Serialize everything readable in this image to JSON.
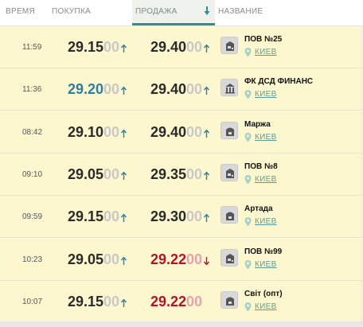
{
  "header": {
    "time_label": "ВРЕМЯ",
    "buy_label": "ПОКУПКА",
    "sell_label": "ПРОДАЖА",
    "name_label": "НАЗВАНИЕ"
  },
  "colors": {
    "row_bg": "#fdf7cf",
    "accent_teal": "#2f8f8a",
    "up_blue": "#2c7ea4",
    "down_red": "#b3142c"
  },
  "rows": [
    {
      "time": "11:59",
      "buy_main": "29.15",
      "buy_dim": "00",
      "buy_arrow": "up",
      "buy_style": "normal",
      "sell_main": "29.40",
      "sell_dim": "00",
      "sell_arrow": "up",
      "sell_style": "normal",
      "icon": "bank-icon",
      "name": "ПОВ №25",
      "city": "КИЕВ"
    },
    {
      "time": "11:36",
      "buy_main": "29.20",
      "buy_dim": "00",
      "buy_arrow": "up",
      "buy_style": "blue",
      "sell_main": "29.40",
      "sell_dim": "00",
      "sell_arrow": "up",
      "sell_style": "normal",
      "icon": "institution-icon",
      "name": "ФК ДСД ФИНАНС",
      "city": "КИЕВ"
    },
    {
      "time": "08:42",
      "buy_main": "29.10",
      "buy_dim": "00",
      "buy_arrow": "up",
      "buy_style": "normal",
      "sell_main": "29.40",
      "sell_dim": "00",
      "sell_arrow": "up",
      "sell_style": "normal",
      "icon": "exchange-icon",
      "name": "Маржа",
      "city": "КИЕВ"
    },
    {
      "time": "09:10",
      "buy_main": "29.05",
      "buy_dim": "00",
      "buy_arrow": "up",
      "buy_style": "normal",
      "sell_main": "29.35",
      "sell_dim": "00",
      "sell_arrow": "up",
      "sell_style": "normal",
      "icon": "bank-icon",
      "name": "ПОВ №8",
      "city": "КИЕВ"
    },
    {
      "time": "09:59",
      "buy_main": "29.15",
      "buy_dim": "00",
      "buy_arrow": "up",
      "buy_style": "normal",
      "sell_main": "29.30",
      "sell_dim": "00",
      "sell_arrow": "up",
      "sell_style": "normal",
      "icon": "exchange-icon",
      "name": "Артада",
      "city": "КИЕВ"
    },
    {
      "time": "10:23",
      "buy_main": "29.05",
      "buy_dim": "00",
      "buy_arrow": "up",
      "buy_style": "normal",
      "sell_main": "29.22",
      "sell_dim": "00",
      "sell_arrow": "down",
      "sell_style": "red",
      "icon": "bank-icon",
      "name": "ПОВ №99",
      "city": "КИЕВ"
    },
    {
      "time": "10:07",
      "buy_main": "29.15",
      "buy_dim": "00",
      "buy_arrow": "up",
      "buy_style": "normal",
      "sell_main": "29.22",
      "sell_dim": "00",
      "sell_arrow": "none",
      "sell_style": "red",
      "icon": "exchange-icon",
      "name": "Світ (опт)",
      "city": "КИЕВ"
    }
  ]
}
